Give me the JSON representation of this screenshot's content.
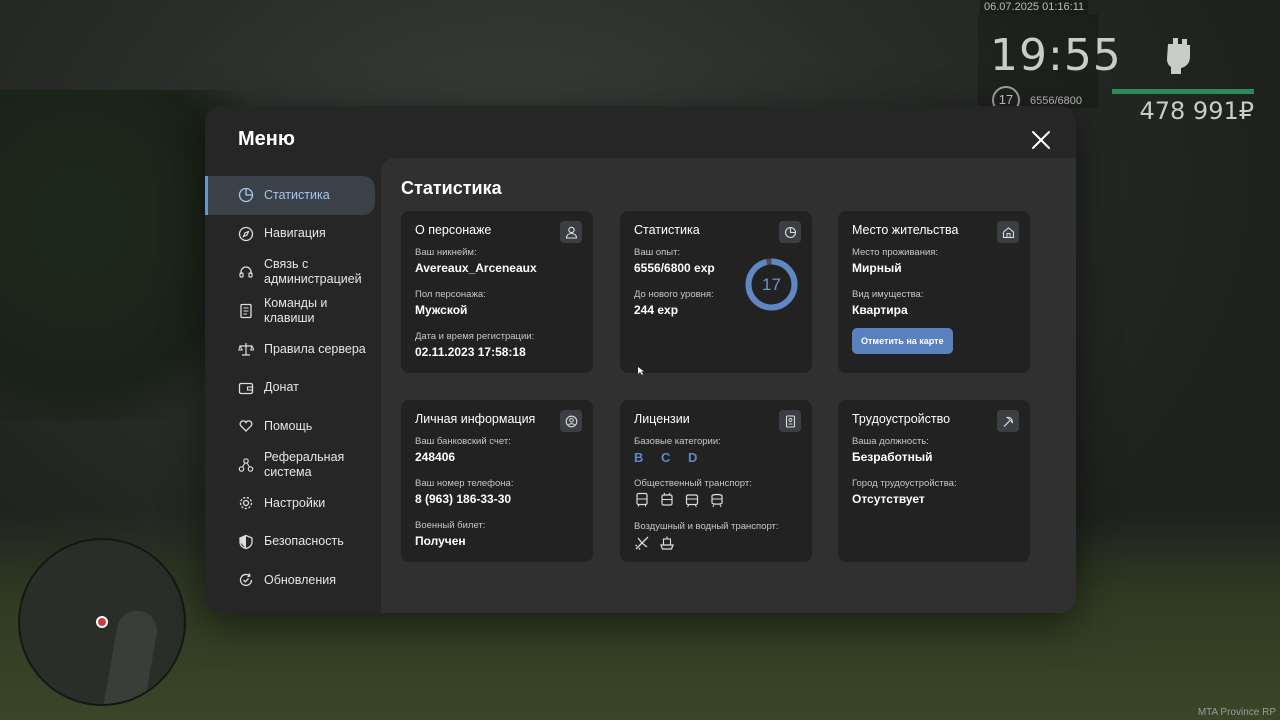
{
  "hud": {
    "datetime": "06.07.2025 01:16:11",
    "time": "19:55",
    "level": "17",
    "exp": "6556/6800",
    "money": "478 991₽",
    "watermark": "MTA Province RP"
  },
  "menu": {
    "title": "Меню",
    "sidebar": [
      {
        "label": "Статистика",
        "icon": "pie-chart-icon",
        "active": true
      },
      {
        "label": "Навигация",
        "icon": "compass-icon"
      },
      {
        "label": "Связь с\nадминистрацией",
        "icon": "headset-icon"
      },
      {
        "label": "Команды и\nклавиши",
        "icon": "document-icon"
      },
      {
        "label": "Правила сервера",
        "icon": "scales-icon"
      },
      {
        "label": "Донат",
        "icon": "wallet-icon"
      },
      {
        "label": "Помощь",
        "icon": "heart-hand-icon"
      },
      {
        "label": "Реферальная\nсистема",
        "icon": "network-icon"
      },
      {
        "label": "Настройки",
        "icon": "gear-icon"
      },
      {
        "label": "Безопасность",
        "icon": "shield-icon"
      },
      {
        "label": "Обновления",
        "icon": "update-icon"
      }
    ]
  },
  "content": {
    "title": "Статистика",
    "character": {
      "title": "О персонаже",
      "nick_label": "Ваш никнейм:",
      "nick": "Avereaux_Arceneaux",
      "gender_label": "Пол персонажа:",
      "gender": "Мужской",
      "reg_label": "Дата и время регистрации:",
      "reg": "02.11.2023 17:58:18"
    },
    "stats": {
      "title": "Статистика",
      "exp_label": "Ваш опыт:",
      "exp": "6556/6800 exp",
      "next_label": "До нового уровня:",
      "next": "244 exp",
      "level": "17",
      "progress": 0.964
    },
    "residence": {
      "title": "Место жительства",
      "place_label": "Место проживания:",
      "place": "Мирный",
      "type_label": "Вид имущества:",
      "type": "Квартира",
      "button": "Отметить на карте"
    },
    "personal": {
      "title": "Личная информация",
      "bank_label": "Ваш банковский счет:",
      "bank": "248406",
      "phone_label": "Ваш номер телефона:",
      "phone": "8 (963) 186-33-30",
      "military_label": "Военный билет:",
      "military": "Получен"
    },
    "licenses": {
      "title": "Лицензии",
      "base_label": "Базовые категории:",
      "categories": "B C D",
      "public_label": "Общественный транспорт:",
      "air_label": "Воздушный и водный транспорт:"
    },
    "job": {
      "title": "Трудоустройство",
      "position_label": "Ваша должность:",
      "position": "Безработный",
      "city_label": "Город трудоустройства:",
      "city": "Отсутствует"
    }
  },
  "colors": {
    "accent": "#5a81bf",
    "ring_bg": "#4a4f55",
    "ring_fg": "#5f87c4"
  }
}
